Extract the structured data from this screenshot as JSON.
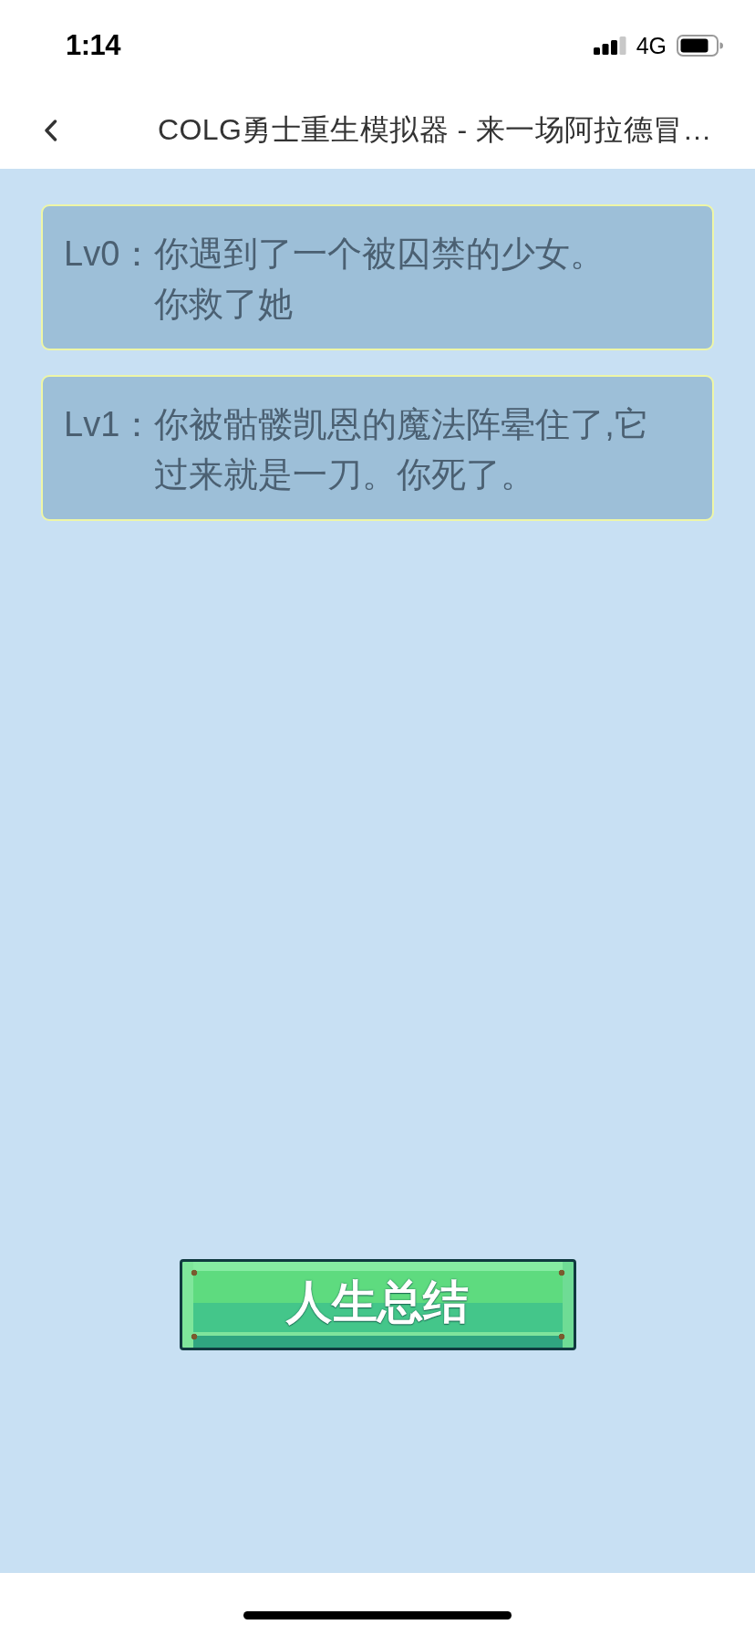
{
  "status_bar": {
    "time": "1:14",
    "network": "4G"
  },
  "nav_bar": {
    "title": "COLG勇士重生模拟器 - 来一场阿拉德冒…"
  },
  "events": [
    {
      "label": "Lv0：",
      "lines": [
        "你遇到了一个被囚禁的少女。",
        "你救了她"
      ]
    },
    {
      "label": "Lv1：",
      "lines": [
        "你被骷髅凯恩的魔法阵晕住了,它过来就是一刀。你死了。"
      ]
    }
  ],
  "summary_button": {
    "label": "人生总结"
  }
}
